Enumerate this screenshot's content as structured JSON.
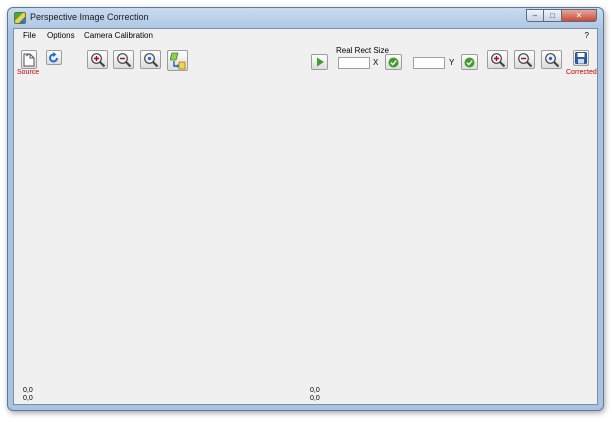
{
  "window": {
    "title": "Perspective Image Correction",
    "controls": {
      "minimize": "–",
      "maximize": "□",
      "close": "✕"
    }
  },
  "menu": {
    "items": [
      "File",
      "Options",
      "Camera Calibration"
    ],
    "help": "?"
  },
  "toolbar": {
    "source_label": "Source",
    "corrected_label": "Corrected",
    "real_rect_size_label": "Real Rect Size",
    "x_label": "X",
    "y_label": "Y",
    "x_value": "",
    "y_value": ""
  },
  "icons": {
    "open": "open-file-icon",
    "rotate": "rotate-icon",
    "zoom_in": "zoom-in-icon",
    "zoom_out": "zoom-out-icon",
    "zoom_fit": "zoom-fit-icon",
    "transform": "transform-icon",
    "run": "play-icon",
    "confirm": "check-icon",
    "save": "save-icon"
  },
  "status": {
    "source_line1": "0,0",
    "source_line2": "0,0",
    "corrected_line1": "0,0",
    "corrected_line2": "0,0"
  },
  "colors": {
    "accent_red": "#cc0000",
    "frame": "#a9c4e2",
    "client_bg": "#f0f0f0",
    "check_green": "#3f9d2f"
  }
}
